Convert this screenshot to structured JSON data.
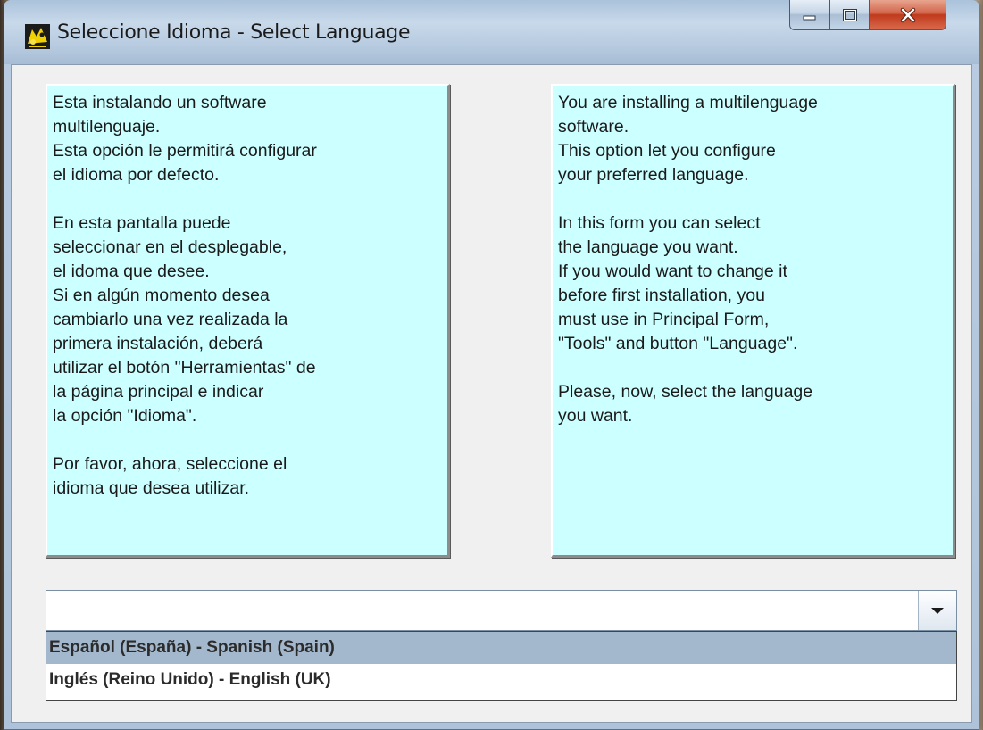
{
  "window": {
    "title": "Seleccione Idioma - Select Language",
    "icon": "app-logo-icon",
    "controls": {
      "minimize": "minimize-icon",
      "maximize": "maximize-icon",
      "close": "close-icon"
    }
  },
  "panes": {
    "spanish_text": "Esta instalando un software\nmultilenguaje.\nEsta opción le permitirá configurar\nel idioma por defecto.\n\nEn esta pantalla puede\nseleccionar en el desplegable,\nel idoma que desee.\nSi en algún momento desea\ncambiarlo una vez realizada la\nprimera instalación, deberá\nutilizar el botón \"Herramientas\" de\nla página principal e indicar\nla opción \"Idioma\".\n\nPor favor, ahora, seleccione el\nidioma que desea utilizar.",
    "english_text": "You are installing a multilenguage\nsoftware.\nThis option let you configure\nyour preferred language.\n\nIn this form you can select\nthe language you want.\nIf you would want to change it\nbefore first installation, you\nmust use in Principal Form,\n\"Tools\" and button \"Language\".\n\nPlease, now, select the language\nyou want."
  },
  "language_combo": {
    "value": "",
    "options": [
      "Español (España) - Spanish (Spain)",
      "Inglés (Reino Unido) - English (UK)"
    ],
    "highlighted_index": 0
  },
  "colors": {
    "pane_background": "#ccffff",
    "highlight": "#a3b8cc",
    "close_button": "#c7432a"
  }
}
